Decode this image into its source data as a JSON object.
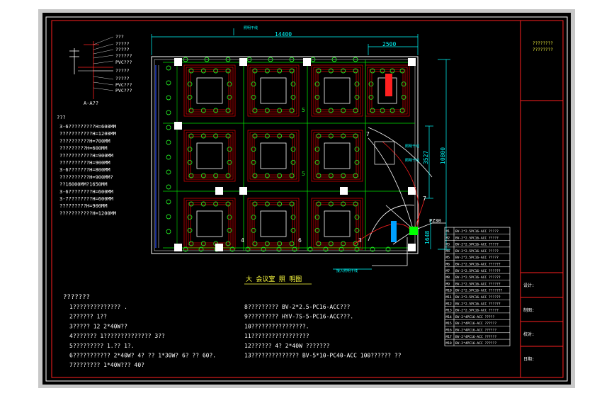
{
  "colors": {
    "page_bg": "#ffffff",
    "frame_bg": "#c8c8c8",
    "drawing_bg": "#000000",
    "border": "#ffffff",
    "inner_border": "#ff2020",
    "grid": "#00e000",
    "ceiling": "#d00000",
    "fixture": "#20e020",
    "dim": "#00ffff",
    "text_white": "#ffffff",
    "text_yellow": "#ffff40",
    "marker": "#00ffff"
  },
  "title_block": {
    "header_line1": "????????",
    "header_line2": "????????",
    "rows": [
      "设计:",
      "制图:",
      "校对:",
      "日期:"
    ]
  },
  "dimensions": {
    "width_total": "14400",
    "width_right": "2500",
    "height_a": "3527",
    "height_b": "10800",
    "height_c": "1648"
  },
  "room_labels": {
    "label_5a": "5",
    "label_5b": "5",
    "label_7a": "7",
    "label_7b": "7",
    "label_4": "4",
    "label_6": "6",
    "label_3": "3",
    "panel_tag": "PZ30",
    "top_callout": "照明干线",
    "right_callout_1": "照明干线",
    "right_callout_2": "照明干线",
    "bottom_callout": "接入照明干线"
  },
  "drawing_title": "大 会议室 照 明图",
  "section_detail": {
    "title": "A-A??",
    "labels": [
      "???",
      "?????",
      "?????",
      "??????",
      "PVC???",
      "?????",
      "?????",
      "PVC???",
      "PVC???"
    ]
  },
  "mount_notes": {
    "heading": "???",
    "lines": [
      "3-6?????????H=600MM",
      "???????????H=1200MM",
      "??????????H=700MM",
      "?????????H=600MM",
      "???????????H=900MM",
      "??????????H=900MM",
      "3-6???????H=800MM",
      "??????????H=900MM?",
      "??16000MM?1650MM",
      "3-6????????H=600MM",
      "3-7????????H=600MM",
      "?????????H=900MM",
      "???????????H=1200MM"
    ]
  },
  "circuit_table": {
    "rows": [
      {
        "id": "M1",
        "desc": "BV-2*2.5PC16-ACC  ?????"
      },
      {
        "id": "M2",
        "desc": "BV-2*2.5PC16-ACC  ?????"
      },
      {
        "id": "M3",
        "desc": "BV-2*2.5PC16-ACC  ?????"
      },
      {
        "id": "M4",
        "desc": "BV-2*2.5PC16-ACC  ?????"
      },
      {
        "id": "M5",
        "desc": "BV-2*2.5PC16-ACC  ?????"
      },
      {
        "id": "M6",
        "desc": "BV-2*2.5PC16-ACC  ??????"
      },
      {
        "id": "M7",
        "desc": "BV-2*2.5PC16-ACC  ??????"
      },
      {
        "id": "M8",
        "desc": "BV-2*2.5PC16-ACC  ??????"
      },
      {
        "id": "M9",
        "desc": "BV-2*2.5PC16-ACC  ??????"
      },
      {
        "id": "M10",
        "desc": "BV-2*2.5PC16-ACC  ???????"
      },
      {
        "id": "M11",
        "desc": "BV-2*2.5PC16-ACC  ??????"
      },
      {
        "id": "M12",
        "desc": "BV-2*2.5PC16-ACC  ??????"
      },
      {
        "id": "M13",
        "desc": "BV-2*2.5PC16-ACC  ?????"
      },
      {
        "id": "M14",
        "desc": "BV-2*4PC16-ACC  ?????"
      },
      {
        "id": "M15",
        "desc": "BV-2*4PC16-ACC  ??????"
      },
      {
        "id": "M16",
        "desc": "BV-2*4PC16-ACC  ??????"
      },
      {
        "id": "M17",
        "desc": "BV-2*4PC16-ACC  ??????"
      },
      {
        "id": "M18",
        "desc": "BV-2*4PC16-ACC  ??????"
      }
    ]
  },
  "notes": {
    "heading": "???????",
    "left": [
      "1??????????????  .",
      "2?????? 1??",
      "3????? 12 2*40W??",
      "4??????? 1??????????????  3??",
      "5?????????  1.?? 1?.",
      "6???????????  2*40W? 4? ?? 1*30W? 6? ?? 60?.",
      "7????????  1*40W???  40?"
    ],
    "right": [
      "8?????????  BV-2*2.5-PC16-ACC???",
      "9?????????  HYV-7S-5-PC16-ACC???.",
      "10????????????????.",
      "11?????????????????",
      "12??????  4? 2*40W     ???????",
      "13??????????????    BV-5*10-PC40-ACC      100??????    ??"
    ]
  }
}
